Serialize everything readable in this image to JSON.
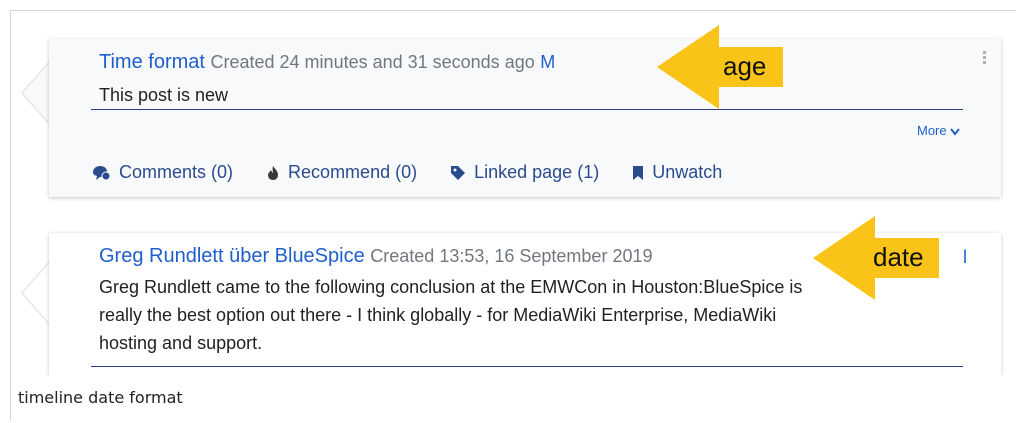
{
  "cards": [
    {
      "title": "Time format",
      "meta_created": "Created 24 minutes and 31 seconds ago",
      "meta_trailing": "M",
      "body": "This post is new",
      "more_label": "More",
      "actions": [
        {
          "icon": "comments-icon",
          "label": "Comments (0)"
        },
        {
          "icon": "flame-icon",
          "label": "Recommend (0)"
        },
        {
          "icon": "tag-icon",
          "label": "Linked page (1)"
        },
        {
          "icon": "bookmark-icon",
          "label": "Unwatch"
        }
      ]
    },
    {
      "title": "Greg Rundlett über BlueSpice",
      "meta_created": "Created 13:53, 16 September 2019",
      "meta_trailing": "l",
      "body_lines": [
        "Greg Rundlett came to the following conclusion at the EMWCon in Houston:BlueSpice is",
        "really the best option out there - I think globally - for MediaWiki Enterprise, MediaWiki",
        "hosting and support."
      ]
    }
  ],
  "callouts": [
    {
      "label": "age",
      "color": "#f9c417"
    },
    {
      "label": "date",
      "color": "#f9c417"
    }
  ],
  "caption": "timeline date format"
}
